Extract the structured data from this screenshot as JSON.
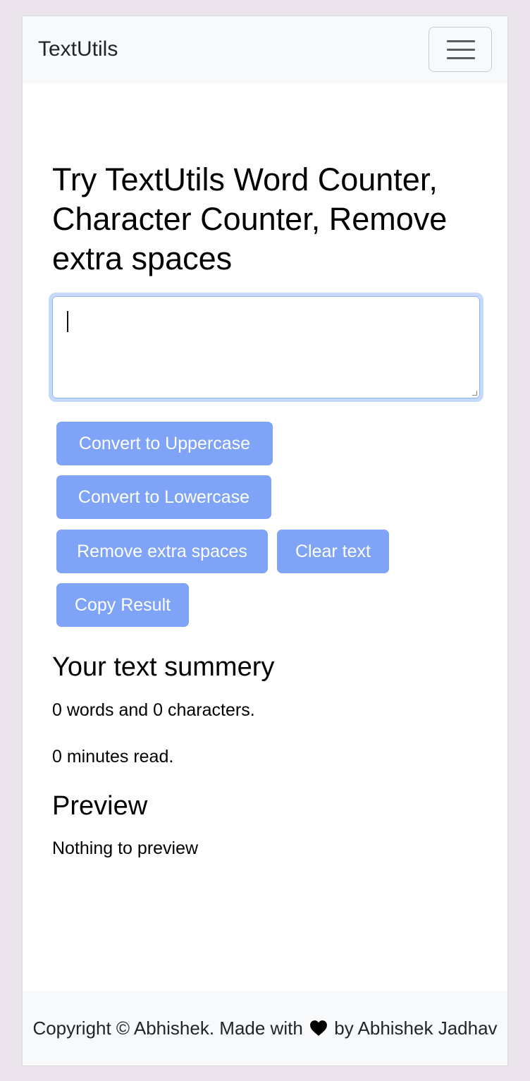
{
  "navbar": {
    "brand": "TextUtils",
    "menu_icon": "hamburger-menu-icon"
  },
  "main": {
    "heading": "Try TextUtils Word Counter, Character Counter, Remove extra spaces",
    "textarea": {
      "value": ""
    },
    "buttons": {
      "uppercase": "Convert to Uppercase",
      "lowercase": "Convert to Lowercase",
      "remove_spaces": "Remove extra spaces",
      "clear": "Clear text",
      "copy": "Copy Result"
    },
    "summary": {
      "title": "Your text summery",
      "counts": "0 words and 0 characters.",
      "read_time": "0 minutes read."
    },
    "preview": {
      "title": "Preview",
      "text": "Nothing to preview"
    }
  },
  "footer": {
    "before_heart": "Copyright © Abhishek. Made with",
    "heart_icon": "heart-icon",
    "after_heart": "by Abhishek Jadhav"
  },
  "colors": {
    "button_bg": "#7ea3f7",
    "navbar_bg": "#f8f9fa",
    "page_bg": "#ece4ec",
    "focus_ring": "#c7d9fb"
  }
}
